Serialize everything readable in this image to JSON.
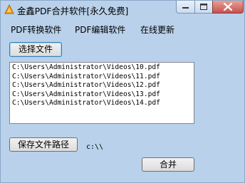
{
  "window": {
    "title": "金鑫PDF合并软件[永久免费]"
  },
  "menu": {
    "items": [
      "PDF转换软件",
      "PDF编辑软件",
      "在线更新"
    ]
  },
  "buttons": {
    "select_file": "选择文件",
    "save_path": "保存文件路径",
    "merge": "合并"
  },
  "file_list": {
    "items": [
      "C:\\Users\\Administrator\\Videos\\10.pdf",
      "C:\\Users\\Administrator\\Videos\\11.pdf",
      "C:\\Users\\Administrator\\Videos\\12.pdf",
      "C:\\Users\\Administrator\\Videos\\13.pdf",
      "C:\\Users\\Administrator\\Videos\\14.pdf"
    ]
  },
  "save_path": {
    "value": "c:\\\\"
  },
  "colors": {
    "window_background": "#b9d1ea",
    "close_button": "#c75050",
    "icon_orange": "#f39c12"
  }
}
